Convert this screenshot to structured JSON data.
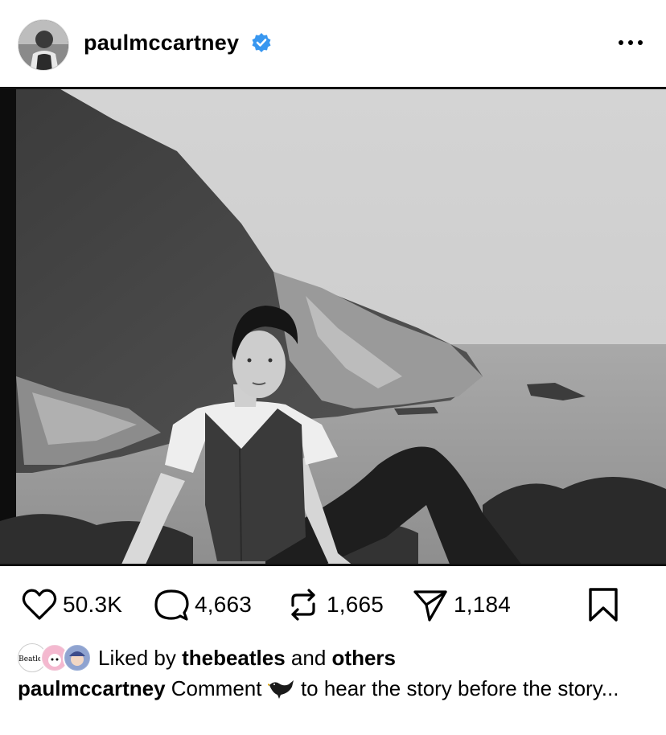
{
  "post": {
    "username": "paulmccartney",
    "verified": true,
    "more_icon": "more-horizontal-icon"
  },
  "photo": {
    "alt_icon": "photo",
    "style": "black-and-white"
  },
  "actions": {
    "likes": "50.3K",
    "comments": "4,663",
    "reposts": "1,665",
    "shares": "1,184"
  },
  "liked_by": {
    "prefix": "Liked by",
    "user": "thebeatles",
    "conjunction": "and",
    "others": "others",
    "avatar_badge": "Beatles"
  },
  "caption": {
    "username": "paulmccartney",
    "text_before": "Comment",
    "emoji": "blackbird",
    "text_after": "to hear the story before the story..."
  },
  "colors": {
    "verified_blue": "#3897f0",
    "text": "#000000"
  }
}
